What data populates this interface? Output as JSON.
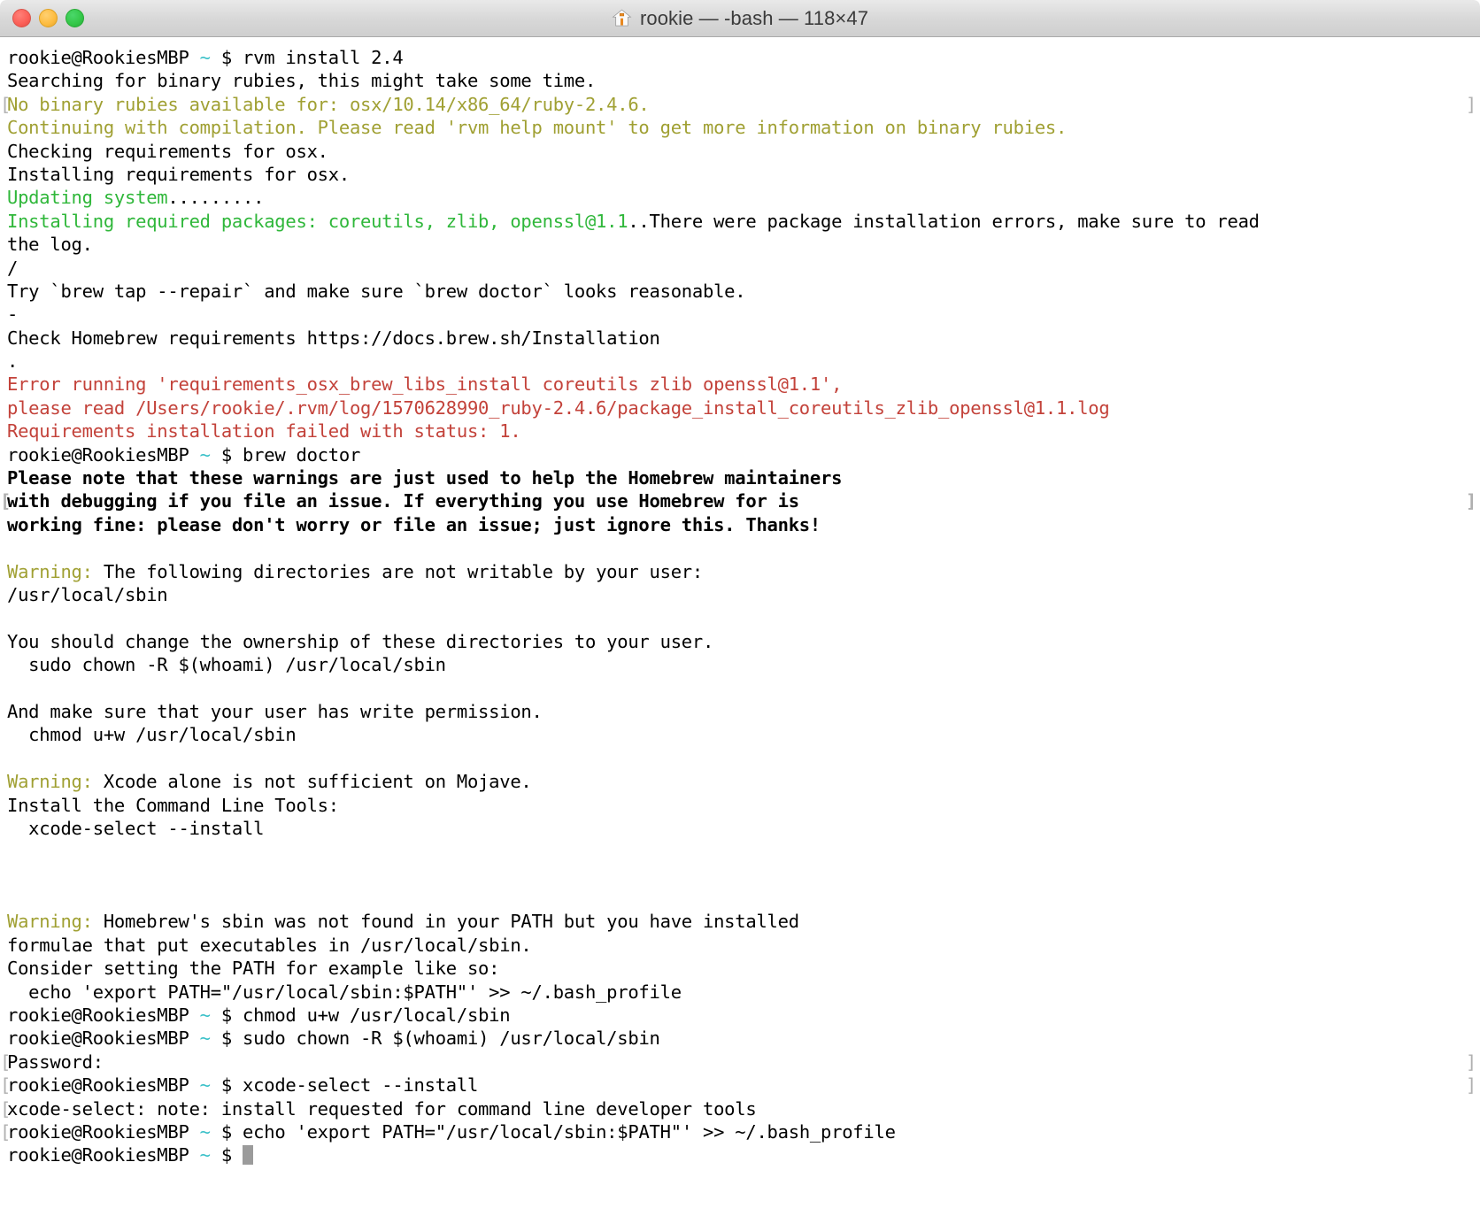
{
  "window": {
    "title": "rookie — -bash — 118×47",
    "title_icon": "home-icon",
    "cols": 118,
    "rows": 47,
    "controls": {
      "close_label": "close",
      "minimize_label": "minimize",
      "zoom_label": "zoom"
    }
  },
  "theme": {
    "background": "#ffffff",
    "foreground": "#000000",
    "green": "#2fb73a",
    "olive": "#a0a033",
    "red": "#c3423a",
    "cyan": "#39c0c8",
    "cursor": "#9b9b9b",
    "wrapmark": "#b0b0b0",
    "titlebar": "#d8d8d8"
  },
  "prompt": {
    "user_host": "rookie@RookiesMBP",
    "cwd": "~",
    "symbol": "$"
  },
  "terminal": {
    "lines": [
      {
        "id": 1,
        "segments": [
          {
            "t": "rookie@RookiesMBP ",
            "c": "black"
          },
          {
            "t": "~",
            "c": "cyan"
          },
          {
            "t": " $ rvm install 2.4",
            "c": "black"
          }
        ]
      },
      {
        "id": 2,
        "segments": [
          {
            "t": "Searching for binary rubies, this might take some time.",
            "c": "black"
          }
        ]
      },
      {
        "id": 3,
        "wrapL": true,
        "wrapR": true,
        "segments": [
          {
            "t": "No binary rubies available for: osx/10.14/x86_64/ruby-2.4.6.",
            "c": "olive"
          }
        ]
      },
      {
        "id": 4,
        "segments": [
          {
            "t": "Continuing with compilation. Please read 'rvm help mount' to get more information on binary rubies.",
            "c": "olive"
          }
        ]
      },
      {
        "id": 5,
        "segments": [
          {
            "t": "Checking requirements for osx.",
            "c": "black"
          }
        ]
      },
      {
        "id": 6,
        "segments": [
          {
            "t": "Installing requirements for osx.",
            "c": "black"
          }
        ]
      },
      {
        "id": 7,
        "segments": [
          {
            "t": "Updating system",
            "c": "green"
          },
          {
            "t": ".........",
            "c": "black"
          }
        ]
      },
      {
        "id": 8,
        "segments": [
          {
            "t": "Installing required packages: coreutils, zlib, openssl@1.1",
            "c": "green"
          },
          {
            "t": "..There were package installation errors, make sure to read",
            "c": "black"
          }
        ]
      },
      {
        "id": 9,
        "segments": [
          {
            "t": "the log.",
            "c": "black"
          }
        ]
      },
      {
        "id": 10,
        "segments": [
          {
            "t": "/",
            "c": "black"
          }
        ]
      },
      {
        "id": 11,
        "segments": [
          {
            "t": "Try `brew tap --repair` and make sure `brew doctor` looks reasonable.",
            "c": "black"
          }
        ]
      },
      {
        "id": 12,
        "segments": [
          {
            "t": "-",
            "c": "black"
          }
        ]
      },
      {
        "id": 13,
        "segments": [
          {
            "t": "Check Homebrew requirements https://docs.brew.sh/Installation",
            "c": "black"
          }
        ]
      },
      {
        "id": 14,
        "segments": [
          {
            "t": ".",
            "c": "black"
          }
        ]
      },
      {
        "id": 15,
        "segments": [
          {
            "t": "Error running 'requirements_osx_brew_libs_install coreutils zlib openssl@1.1',",
            "c": "red"
          }
        ]
      },
      {
        "id": 16,
        "segments": [
          {
            "t": "please read /Users/rookie/.rvm/log/1570628990_ruby-2.4.6/package_install_coreutils_zlib_openssl@1.1.log",
            "c": "red"
          }
        ]
      },
      {
        "id": 17,
        "segments": [
          {
            "t": "Requirements installation failed with status: 1.",
            "c": "red"
          }
        ]
      },
      {
        "id": 18,
        "segments": [
          {
            "t": "rookie@RookiesMBP ",
            "c": "black"
          },
          {
            "t": "~",
            "c": "cyan"
          },
          {
            "t": " $ brew doctor",
            "c": "black"
          }
        ]
      },
      {
        "id": 19,
        "bold": true,
        "segments": [
          {
            "t": "Please note that these warnings are just used to help the Homebrew maintainers",
            "c": "black"
          }
        ]
      },
      {
        "id": 20,
        "bold": true,
        "wrapL": true,
        "wrapR": true,
        "segments": [
          {
            "t": "with debugging if you file an issue. If everything you use Homebrew for is",
            "c": "black"
          }
        ]
      },
      {
        "id": 21,
        "bold": true,
        "segments": [
          {
            "t": "working fine: please don't worry or file an issue; just ignore this. Thanks!",
            "c": "black"
          }
        ]
      },
      {
        "id": 22,
        "segments": [
          {
            "t": "",
            "c": "black"
          }
        ]
      },
      {
        "id": 23,
        "segments": [
          {
            "t": "Warning:",
            "c": "olive"
          },
          {
            "t": " The following directories are not writable by your user:",
            "c": "black"
          }
        ]
      },
      {
        "id": 24,
        "segments": [
          {
            "t": "/usr/local/sbin",
            "c": "black"
          }
        ]
      },
      {
        "id": 25,
        "segments": [
          {
            "t": "",
            "c": "black"
          }
        ]
      },
      {
        "id": 26,
        "segments": [
          {
            "t": "You should change the ownership of these directories to your user.",
            "c": "black"
          }
        ]
      },
      {
        "id": 27,
        "segments": [
          {
            "t": "  sudo chown -R $(whoami) /usr/local/sbin",
            "c": "black"
          }
        ]
      },
      {
        "id": 28,
        "segments": [
          {
            "t": "",
            "c": "black"
          }
        ]
      },
      {
        "id": 29,
        "segments": [
          {
            "t": "And make sure that your user has write permission.",
            "c": "black"
          }
        ]
      },
      {
        "id": 30,
        "segments": [
          {
            "t": "  chmod u+w /usr/local/sbin",
            "c": "black"
          }
        ]
      },
      {
        "id": 31,
        "segments": [
          {
            "t": "",
            "c": "black"
          }
        ]
      },
      {
        "id": 32,
        "segments": [
          {
            "t": "Warning:",
            "c": "olive"
          },
          {
            "t": " Xcode alone is not sufficient on Mojave.",
            "c": "black"
          }
        ]
      },
      {
        "id": 33,
        "segments": [
          {
            "t": "Install the Command Line Tools:",
            "c": "black"
          }
        ]
      },
      {
        "id": 34,
        "segments": [
          {
            "t": "  xcode-select --install",
            "c": "black"
          }
        ]
      },
      {
        "id": 35,
        "segments": [
          {
            "t": "",
            "c": "black"
          }
        ]
      },
      {
        "id": 36,
        "segments": [
          {
            "t": "",
            "c": "black"
          }
        ]
      },
      {
        "id": 37,
        "segments": [
          {
            "t": "",
            "c": "black"
          }
        ]
      },
      {
        "id": 38,
        "segments": [
          {
            "t": "Warning:",
            "c": "olive"
          },
          {
            "t": " Homebrew's sbin was not found in your PATH but you have installed",
            "c": "black"
          }
        ]
      },
      {
        "id": 39,
        "segments": [
          {
            "t": "formulae that put executables in /usr/local/sbin.",
            "c": "black"
          }
        ]
      },
      {
        "id": 40,
        "segments": [
          {
            "t": "Consider setting the PATH for example like so:",
            "c": "black"
          }
        ]
      },
      {
        "id": 41,
        "segments": [
          {
            "t": "  echo 'export PATH=\"/usr/local/sbin:$PATH\"' >> ~/.bash_profile",
            "c": "black"
          }
        ]
      },
      {
        "id": 42,
        "segments": [
          {
            "t": "rookie@RookiesMBP ",
            "c": "black"
          },
          {
            "t": "~",
            "c": "cyan"
          },
          {
            "t": " $ chmod u+w /usr/local/sbin",
            "c": "black"
          }
        ]
      },
      {
        "id": 43,
        "segments": [
          {
            "t": "rookie@RookiesMBP ",
            "c": "black"
          },
          {
            "t": "~",
            "c": "cyan"
          },
          {
            "t": " $ sudo chown -R $(whoami) /usr/local/sbin",
            "c": "black"
          }
        ]
      },
      {
        "id": 44,
        "wrapL": true,
        "wrapR": true,
        "segments": [
          {
            "t": "Password:",
            "c": "black"
          }
        ]
      },
      {
        "id": 45,
        "wrapL": true,
        "wrapR": true,
        "segments": [
          {
            "t": "rookie@RookiesMBP ",
            "c": "black"
          },
          {
            "t": "~",
            "c": "cyan"
          },
          {
            "t": " $ xcode-select --install",
            "c": "black"
          }
        ]
      },
      {
        "id": 46,
        "wrapL": true,
        "segments": [
          {
            "t": "xcode-select: note: install requested for command line developer tools",
            "c": "black"
          }
        ]
      },
      {
        "id": 47,
        "wrapL": true,
        "segments": [
          {
            "t": "rookie@RookiesMBP ",
            "c": "black"
          },
          {
            "t": "~",
            "c": "cyan"
          },
          {
            "t": " $ echo 'export PATH=\"/usr/local/sbin:$PATH\"' >> ~/.bash_profile",
            "c": "black"
          }
        ]
      },
      {
        "id": 48,
        "cursor": true,
        "segments": [
          {
            "t": "rookie@RookiesMBP ",
            "c": "black"
          },
          {
            "t": "~",
            "c": "cyan"
          },
          {
            "t": " $ ",
            "c": "black"
          }
        ]
      }
    ]
  }
}
